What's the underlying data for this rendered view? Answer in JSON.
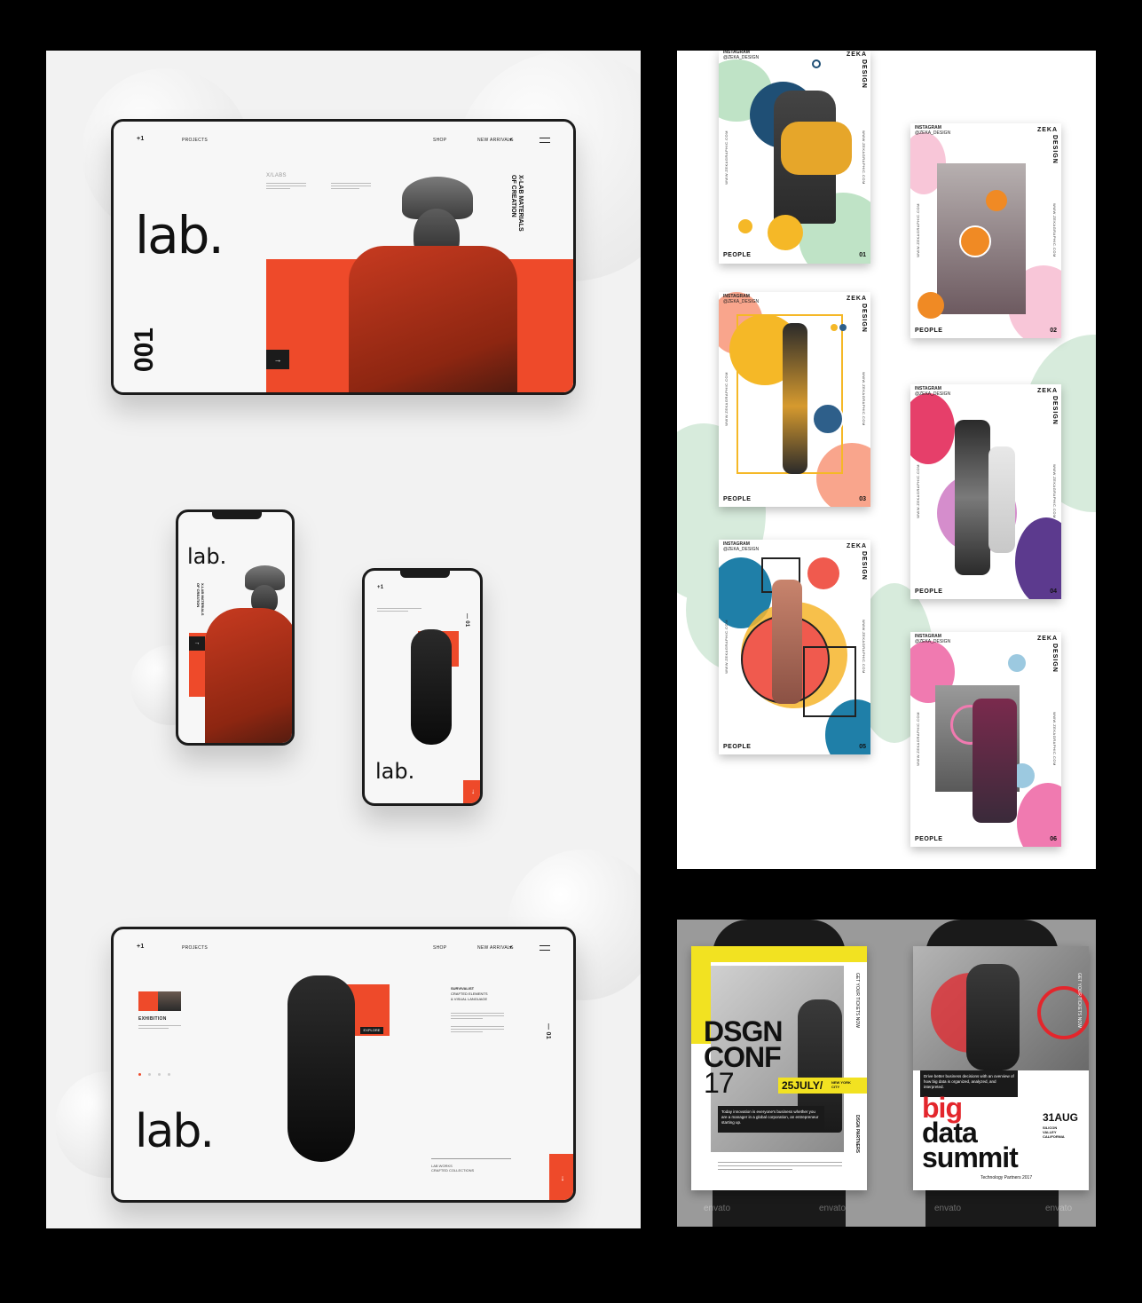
{
  "left_panel": {
    "desktop1": {
      "logo": "+1",
      "nav_projects": "PROJECTS",
      "nav_shop": "SHOP",
      "nav_new_arrivals": "NEW ARRIVALS",
      "chevron": "▾",
      "xlabs": "X/LABS",
      "brand": "lab.",
      "vertical_title_1": "X-LAB",
      "vertical_title_2": "MATERIALS",
      "vertical_title_3": "OF CREATION",
      "big_number": "001",
      "arrow": "→"
    },
    "phone1": {
      "brand": "lab.",
      "vertical_title_1": "X-LAB",
      "vertical_title_2": "MATERIALS",
      "vertical_title_3": "OF CREATION",
      "arrow": "→"
    },
    "phone2": {
      "logo": "+1",
      "brand": "lab.",
      "counter": "— 01",
      "arrow": "↓"
    },
    "desktop2": {
      "logo": "+1",
      "nav_projects": "PROJECTS",
      "nav_shop": "SHOP",
      "nav_new_arrivals": "NEW ARRIVALS",
      "chevron": "▾",
      "exhibition": "EXHIBITION",
      "survivalist_1": "SURVIVALIST",
      "survivalist_2": "CRAFTED ELEMENTS",
      "survivalist_3": "& VISUAL LANGUAGE",
      "counter": "— 01",
      "brand": "lab.",
      "footer_1": "LAB WORKS",
      "footer_2": "CRAFTED COLLECTIONS",
      "explore": "EXPLORE",
      "arrow": "↓"
    }
  },
  "posters": {
    "instagram": "INSTAGRAM",
    "handle": "@ZEKA_DESIGN",
    "zeka": "ZEKA",
    "design": "DESIGN",
    "url": "WWW.ZEKAGRAPHIC.COM",
    "people": "PEOPLE",
    "items": [
      {
        "num": "01"
      },
      {
        "num": "02"
      },
      {
        "num": "03"
      },
      {
        "num": "04"
      },
      {
        "num": "05"
      },
      {
        "num": "06"
      }
    ]
  },
  "conf": {
    "left": {
      "title_1": "DSGN",
      "title_2": "CONF",
      "title_3": "17",
      "date": "25JULY/",
      "city": "NEW YORK CITY",
      "side_top": "GET YOUR TICKETS NOW",
      "side_bottom": "DSGN PARTNERS",
      "body": "Today innovation is everyone's business whether you are a manager in a global corporation, an entrepreneur starting up."
    },
    "right": {
      "title_1": "big",
      "title_2": "data",
      "title_3": "summit",
      "date": "31AUG",
      "location_1": "SILICON",
      "location_2": "VALLEY",
      "location_3": "CALIFORNIA",
      "side_top": "GET YOUR TICKETS NOW",
      "tagline": "Drive better business decisions with an overview of how big data is organized, analyzed, and interpreted.",
      "partners": "Technology Partners 2017"
    },
    "watermark": "envato"
  },
  "colors": {
    "accent_orange": "#ee4a2a",
    "conf_yellow": "#f2e221",
    "summit_red": "#e3262c"
  }
}
